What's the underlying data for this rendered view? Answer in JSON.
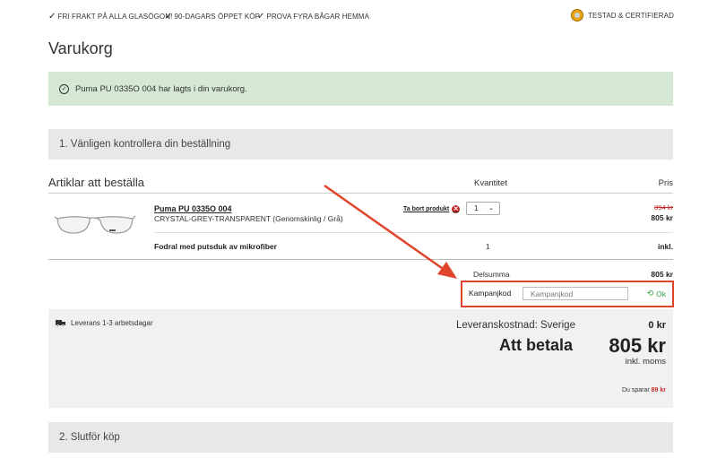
{
  "usp_bar": {
    "items": [
      "FRI FRAKT PÅ ALLA GLASÖGON!",
      "90-DAGARS ÖPPET KÖP",
      "PROVA FYRA BÅGAR HEMMA"
    ],
    "certified": "TESTAD & CERTIFIERAD"
  },
  "page_title": "Varukorg",
  "alert": {
    "message": "Puma PU 0335O 004 har lagts i din varukorg.",
    "icon": "check-circle-icon"
  },
  "step1": {
    "label": "1. Vänligen kontrollera din beställning"
  },
  "cart": {
    "headers": {
      "items": "Artiklar att beställa",
      "quantity": "Kvantitet",
      "price": "Pris"
    },
    "product": {
      "name": "Puma PU 0335O 004",
      "variant": "CRYSTAL-GREY-TRANSPARENT (Genomskinlig / Grå)",
      "remove_label": "Ta bort produkt",
      "quantity": "1",
      "price_old": "894 kr",
      "price_new": "805 kr"
    },
    "accessory": {
      "name": "Fodral med putsduk av mikrofiber",
      "quantity": "1",
      "price": "inkl."
    },
    "subtotal_label": "Delsumma",
    "subtotal_value": "805 kr",
    "promo": {
      "label": "Kampanjkod",
      "placeholder": "Kampanjkod",
      "button": "Ok"
    }
  },
  "summary": {
    "delivery": "Leverans 1-3 arbetsdagar",
    "shipping_label": "Leveranskostnad: Sverige",
    "shipping_value": "0 kr",
    "pay_label": "Att betala",
    "pay_value": "805 kr",
    "vat": "inkl. moms",
    "savings_prefix": "Du sparar",
    "savings_value": "89 kr"
  },
  "step2": {
    "label": "2. Slutför köp"
  },
  "colors": {
    "alert_bg": "#d4e8d4",
    "section_bg": "#e8e8e8",
    "annotation": "#e0442a",
    "price_old": "#c62828",
    "ok_green": "#2e9e3e"
  }
}
